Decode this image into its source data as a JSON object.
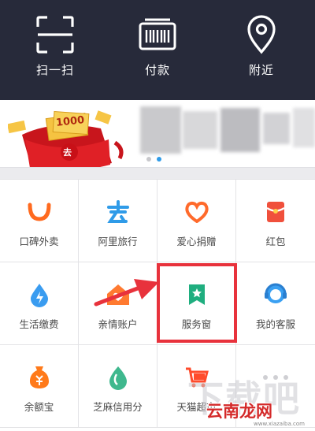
{
  "top": {
    "items": [
      {
        "label": "扫一扫",
        "icon": "scan-icon"
      },
      {
        "label": "付款",
        "icon": "barcode-icon"
      },
      {
        "label": "附近",
        "icon": "location-pin-icon"
      }
    ]
  },
  "banner": {
    "badge_text": "1000",
    "envelope_text": "去",
    "active_dot": 2
  },
  "grid": {
    "items": [
      {
        "label": "口碑外卖",
        "icon": "koubei-takeout-icon",
        "color": "#ff6a1f"
      },
      {
        "label": "阿里旅行",
        "icon": "ali-travel-icon",
        "color": "#2f9be8"
      },
      {
        "label": "爱心捐赠",
        "icon": "charity-heart-icon",
        "color": "#ff6a2b"
      },
      {
        "label": "红包",
        "icon": "red-envelope-icon",
        "color": "#f0503c"
      },
      {
        "label": "生活缴费",
        "icon": "utility-drop-icon",
        "color": "#3a9cf0"
      },
      {
        "label": "亲情账户",
        "icon": "family-account-icon",
        "color": "#ff7a30"
      },
      {
        "label": "服务窗",
        "icon": "service-window-icon",
        "color": "#1fae7f"
      },
      {
        "label": "我的客服",
        "icon": "customer-service-icon",
        "color": "#3aa0f2"
      },
      {
        "label": "余额宝",
        "icon": "yuebao-icon",
        "color": "#ff7a1a"
      },
      {
        "label": "芝麻信用分",
        "icon": "sesame-credit-icon",
        "color": "#3fb88e"
      },
      {
        "label": "天猫超市",
        "icon": "tmall-supermarket-icon",
        "color": "#ff4b2b"
      }
    ]
  },
  "watermark": {
    "big": "下载吧",
    "red": "云南龙网",
    "url": "www.xiazaiba.com"
  },
  "colors": {
    "topbar": "#272a3a",
    "highlight": "#e8323c"
  }
}
